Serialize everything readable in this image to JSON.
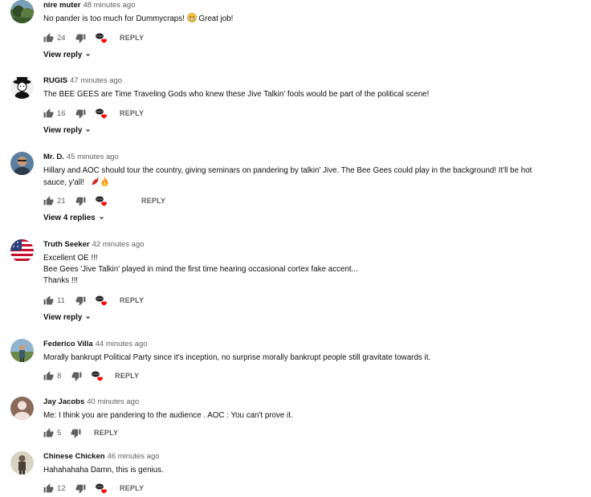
{
  "comments": [
    {
      "author": "nire muter",
      "time": "48 minutes ago",
      "lines": [
        "No pander is too much for Dummycraps!"
      ],
      "likes": "24",
      "reply_label": "REPLY",
      "view_replies": "View reply"
    },
    {
      "author": "RUGIS",
      "time": "47 minutes ago",
      "lines": [
        "The BEE GEES are Time Traveling Gods who knew these Jive Talkin' fools would be part of the political scene!"
      ],
      "likes": "16",
      "reply_label": "REPLY",
      "view_replies": "View reply"
    },
    {
      "author": "Mr. D.",
      "time": "45 minutes ago",
      "lines": [
        "Hillary and AOC should tour the country, giving seminars on pandering by talkin' Jive.   The Bee Gees could play in the background!  It'll be hot",
        "sauce, y'all!"
      ],
      "likes": "21",
      "reply_label": "REPLY",
      "view_replies": "View 4 replies"
    },
    {
      "author": "Truth Seeker",
      "time": "42 minutes ago",
      "lines": [
        "Excellent OE !!!",
        "Bee Gees 'Jive Talkin' played in mind the first time hearing occasional cortex fake accent...",
        "Thanks !!!"
      ],
      "likes": "11",
      "reply_label": "REPLY",
      "view_replies": "View reply"
    },
    {
      "author": "Federico Villa",
      "time": "44 minutes ago",
      "lines": [
        "Morally bankrupt Political Party since it's inception, no surprise morally bankrupt people still gravitate towards it."
      ],
      "likes": "8",
      "reply_label": "REPLY"
    },
    {
      "author": "Jay Jacobs",
      "time": "40 minutes ago",
      "lines": [
        "Me: I think  you are pandering  to the audience .  AOC  : You  can't  prove it."
      ],
      "likes": "5",
      "reply_label": "REPLY"
    },
    {
      "author": "Chinese Chicken",
      "time": "46 minutes ago",
      "lines": [
        "Hahahahaha Damn, this is genius."
      ],
      "likes": "12",
      "reply_label": "REPLY"
    }
  ],
  "icons": {
    "like": "thumb-up-icon",
    "dislike": "thumb-down-icon",
    "hearted": "creator-heart-icon",
    "expand": "chevron-down-icon"
  },
  "colors": {
    "heart": "#ff0000",
    "secondary_text": "#606060",
    "icon": "#606060"
  }
}
